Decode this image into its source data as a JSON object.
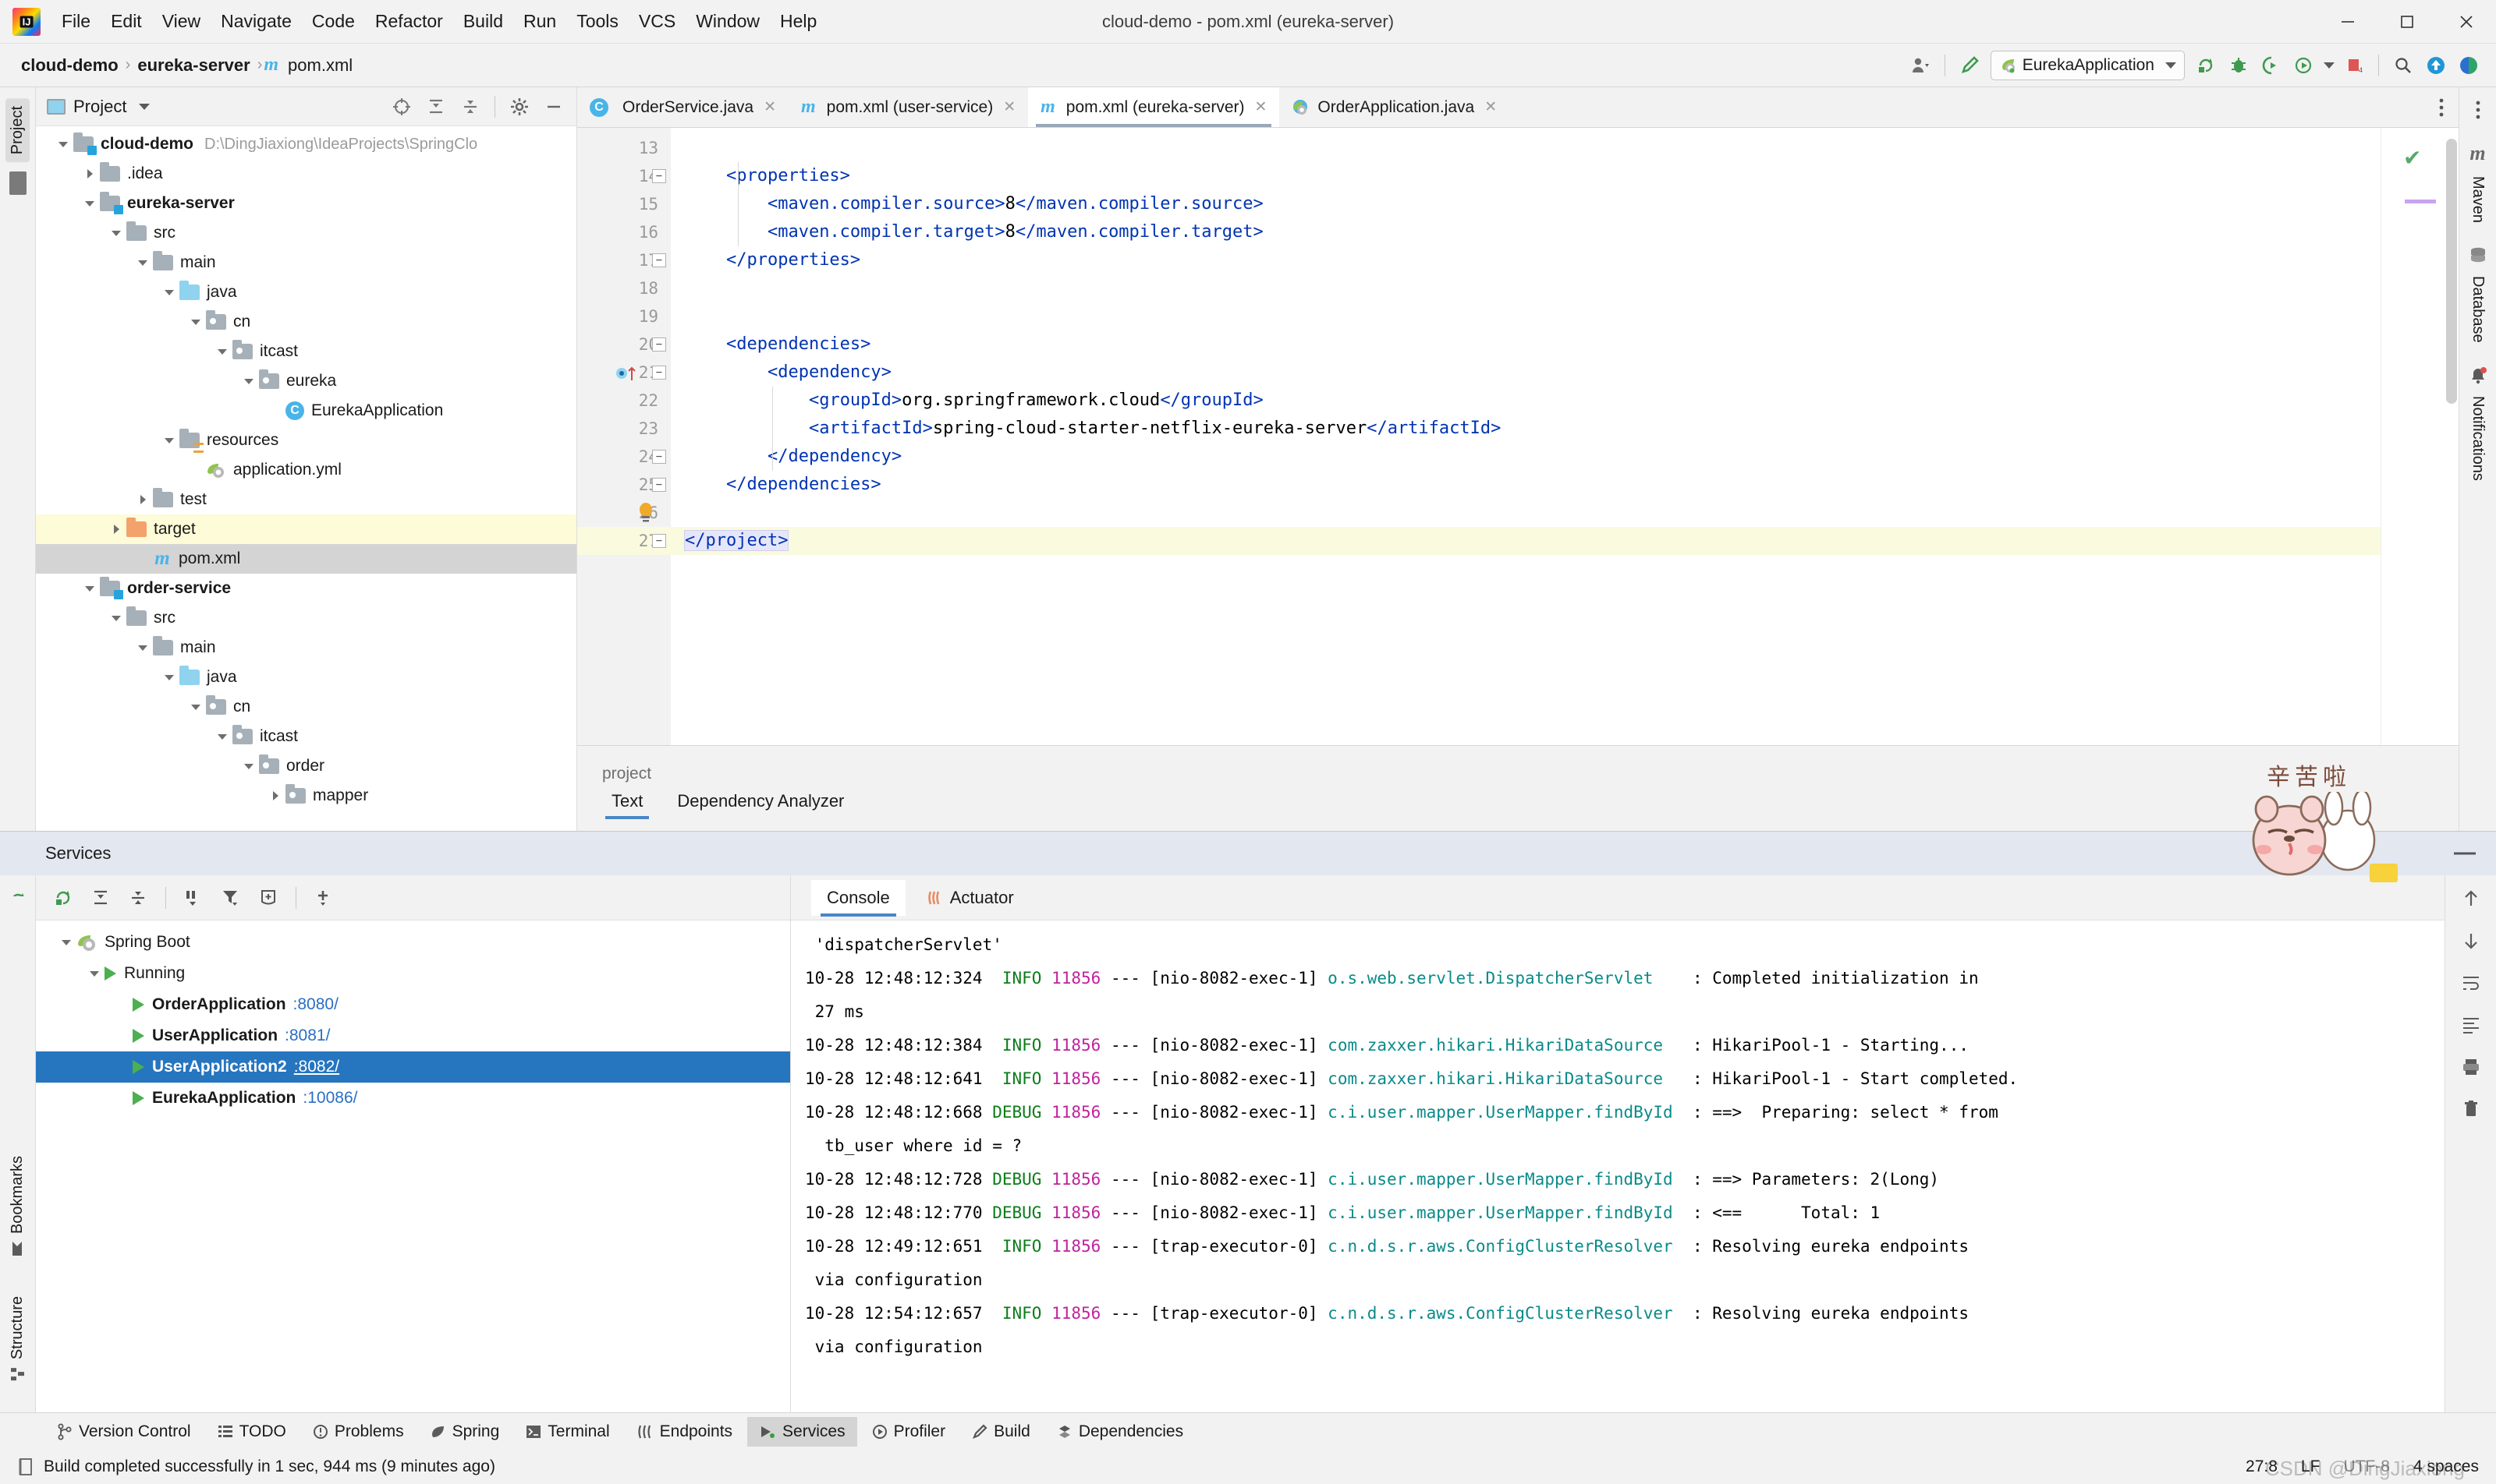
{
  "window": {
    "title": "cloud-demo - pom.xml (eureka-server)",
    "minimize_label": "—",
    "maximize_label": "❐",
    "close_label": "✕"
  },
  "menu": [
    {
      "label": "File"
    },
    {
      "label": "Edit"
    },
    {
      "label": "View"
    },
    {
      "label": "Navigate"
    },
    {
      "label": "Code"
    },
    {
      "label": "Refactor"
    },
    {
      "label": "Build"
    },
    {
      "label": "Run"
    },
    {
      "label": "Tools"
    },
    {
      "label": "VCS"
    },
    {
      "label": "Window"
    },
    {
      "label": "Help"
    }
  ],
  "navbar": {
    "breadcrumbs": [
      {
        "label": "cloud-demo",
        "bold": true
      },
      {
        "label": "eureka-server",
        "bold": true
      },
      {
        "label": "pom.xml",
        "bold": false,
        "icon": "maven-m-icon"
      }
    ],
    "separator": "›",
    "run_config": "EurekaApplication",
    "toolbar_icons": [
      "user-avatar-icon",
      "hammer-build-icon",
      "run-rerun-icon",
      "debug-bug-icon",
      "run-with-coverage-icon",
      "profiler-icon",
      "stop-icon",
      "search-icon",
      "update-project-icon",
      "ide-assistant-icon"
    ]
  },
  "left_strip": {
    "tabs": [
      "Project",
      "Bookmarks",
      "Structure"
    ]
  },
  "project_panel": {
    "title": "Project",
    "toolbar_icons": [
      "select-opened-file-icon",
      "expand-all-icon",
      "collapse-all-icon",
      "settings-gear-icon",
      "hide-icon"
    ],
    "tree": [
      {
        "depth": 0,
        "label": "cloud-demo",
        "path": "D:\\DingJiaxiong\\IdeaProjects\\SpringClo",
        "icon": "module-folder-icon",
        "arrow": "down",
        "bold": true
      },
      {
        "depth": 1,
        "label": ".idea",
        "icon": "folder-icon",
        "arrow": "right",
        "bold": false
      },
      {
        "depth": 1,
        "label": "eureka-server",
        "icon": "module-folder-icon",
        "arrow": "down",
        "bold": true
      },
      {
        "depth": 2,
        "label": "src",
        "icon": "folder-icon",
        "arrow": "down",
        "bold": false
      },
      {
        "depth": 3,
        "label": "main",
        "icon": "folder-icon",
        "arrow": "down",
        "bold": false
      },
      {
        "depth": 4,
        "label": "java",
        "icon": "source-folder-icon",
        "arrow": "down",
        "bold": false
      },
      {
        "depth": 5,
        "label": "cn",
        "icon": "package-folder-icon",
        "arrow": "down",
        "bold": false
      },
      {
        "depth": 6,
        "label": "itcast",
        "icon": "package-folder-icon",
        "arrow": "down",
        "bold": false
      },
      {
        "depth": 7,
        "label": "eureka",
        "icon": "package-folder-icon",
        "arrow": "down",
        "bold": false
      },
      {
        "depth": 8,
        "label": "EurekaApplication",
        "icon": "java-class-icon",
        "arrow": "none",
        "bold": false
      },
      {
        "depth": 4,
        "label": "resources",
        "icon": "resources-folder-icon",
        "arrow": "down",
        "bold": false
      },
      {
        "depth": 5,
        "label": "application.yml",
        "icon": "spring-yaml-icon",
        "arrow": "none",
        "bold": false
      },
      {
        "depth": 3,
        "label": "test",
        "icon": "folder-icon",
        "arrow": "right",
        "bold": false
      },
      {
        "depth": 2,
        "label": "target",
        "icon": "excluded-folder-icon",
        "arrow": "right",
        "bold": false,
        "highlight": "yellow"
      },
      {
        "depth": 3,
        "label": "pom.xml",
        "icon": "maven-m-icon",
        "arrow": "none",
        "bold": false,
        "highlight": "grey"
      },
      {
        "depth": 1,
        "label": "order-service",
        "icon": "module-folder-icon",
        "arrow": "down",
        "bold": true
      },
      {
        "depth": 2,
        "label": "src",
        "icon": "folder-icon",
        "arrow": "down",
        "bold": false
      },
      {
        "depth": 3,
        "label": "main",
        "icon": "folder-icon",
        "arrow": "down",
        "bold": false
      },
      {
        "depth": 4,
        "label": "java",
        "icon": "source-folder-icon",
        "arrow": "down",
        "bold": false
      },
      {
        "depth": 5,
        "label": "cn",
        "icon": "package-folder-icon",
        "arrow": "down",
        "bold": false
      },
      {
        "depth": 6,
        "label": "itcast",
        "icon": "package-folder-icon",
        "arrow": "down",
        "bold": false
      },
      {
        "depth": 7,
        "label": "order",
        "icon": "package-folder-icon",
        "arrow": "down",
        "bold": false
      },
      {
        "depth": 8,
        "label": "mapper",
        "icon": "package-folder-icon",
        "arrow": "right",
        "bold": false
      }
    ]
  },
  "editor": {
    "tabs": [
      {
        "label": "OrderService.java",
        "icon": "java-class-icon",
        "active": false
      },
      {
        "label": "pom.xml (user-service)",
        "icon": "maven-m-icon",
        "active": false
      },
      {
        "label": "pom.xml (eureka-server)",
        "icon": "maven-m-icon",
        "active": true
      },
      {
        "label": "OrderApplication.java",
        "icon": "spring-class-icon",
        "active": false
      }
    ],
    "lines": [
      {
        "no": "13",
        "text": "",
        "fold": "none"
      },
      {
        "no": "14",
        "text": "    <properties>",
        "fold": "start"
      },
      {
        "no": "15",
        "text": "        <maven.compiler.source>8</maven.compiler.source>",
        "fold": "none"
      },
      {
        "no": "16",
        "text": "        <maven.compiler.target>8</maven.compiler.target>",
        "fold": "none"
      },
      {
        "no": "17",
        "text": "    </properties>",
        "fold": "end"
      },
      {
        "no": "18",
        "text": "",
        "fold": "none"
      },
      {
        "no": "19",
        "text": "",
        "fold": "none"
      },
      {
        "no": "20",
        "text": "    <dependencies>",
        "fold": "start"
      },
      {
        "no": "21",
        "text": "        <dependency>",
        "fold": "start",
        "marker": "run-gutter-icon"
      },
      {
        "no": "22",
        "text": "            <groupId>org.springframework.cloud</groupId>",
        "fold": "none"
      },
      {
        "no": "23",
        "text": "            <artifactId>spring-cloud-starter-netflix-eureka-server</artifactId>",
        "fold": "none"
      },
      {
        "no": "24",
        "text": "        </dependency>",
        "fold": "end"
      },
      {
        "no": "25",
        "text": "    </dependencies>",
        "fold": "end"
      },
      {
        "no": "26",
        "text": "",
        "fold": "none",
        "marker": "intention-bulb-icon"
      },
      {
        "no": "27",
        "text": "</project>",
        "fold": "end",
        "highlight": true
      }
    ],
    "footer": {
      "label": "project",
      "tabs": [
        {
          "label": "Text",
          "active": true
        },
        {
          "label": "Dependency Analyzer",
          "active": false
        }
      ]
    },
    "inspection_status": "ok"
  },
  "right_strip": {
    "tabs": [
      {
        "label": "Maven",
        "icon": "maven-m-icon"
      },
      {
        "label": "Database",
        "icon": "database-icon"
      },
      {
        "label": "Notifications",
        "icon": "bell-icon",
        "badge": true
      }
    ]
  },
  "services": {
    "title": "Services",
    "toolbar_icons": [
      "rerun-icon",
      "expand-all-icon",
      "collapse-all-icon",
      "group-by-icon",
      "filter-icon",
      "show-config-icon",
      "add-service-icon"
    ],
    "side_icons": [
      "rerun-icon",
      "debug-icon",
      "stop-icon",
      "wrench-icon",
      "camera-icon",
      "settings-icon",
      "exit-icon",
      "layout-icon"
    ],
    "tree": [
      {
        "depth": 0,
        "label": "Spring Boot",
        "port": "",
        "icon": "spring-boot-icon",
        "arrow": "down",
        "bold": false,
        "selected": false
      },
      {
        "depth": 1,
        "label": "Running",
        "port": "",
        "icon": "run-play-icon",
        "arrow": "down",
        "bold": false,
        "selected": false
      },
      {
        "depth": 2,
        "label": "OrderApplication",
        "port": ":8080/",
        "icon": "run-play-icon",
        "arrow": "none",
        "bold": true,
        "selected": false
      },
      {
        "depth": 2,
        "label": "UserApplication",
        "port": ":8081/",
        "icon": "run-play-icon",
        "arrow": "none",
        "bold": true,
        "selected": false
      },
      {
        "depth": 2,
        "label": "UserApplication2",
        "port": ":8082/",
        "icon": "run-play-icon",
        "arrow": "none",
        "bold": true,
        "selected": true
      },
      {
        "depth": 2,
        "label": "EurekaApplication",
        "port": ":10086/",
        "icon": "run-play-icon",
        "arrow": "none",
        "bold": true,
        "selected": false
      }
    ],
    "console_tabs": [
      {
        "label": "Console",
        "active": true,
        "icon": "console-icon"
      },
      {
        "label": "Actuator",
        "active": false,
        "icon": "actuator-icon"
      }
    ],
    "console_lines": [
      {
        "type": "cont",
        "text": " 'dispatcherServlet'"
      },
      {
        "type": "log",
        "ts": "10-28 12:48:12:324",
        "level": "INFO",
        "pid": "11856",
        "thread": "[nio-8082-exec-1]",
        "logger": "o.s.web.servlet.DispatcherServlet",
        "msg": ": Completed initialization in"
      },
      {
        "type": "cont",
        "text": " 27 ms"
      },
      {
        "type": "log",
        "ts": "10-28 12:48:12:384",
        "level": "INFO",
        "pid": "11856",
        "thread": "[nio-8082-exec-1]",
        "logger": "com.zaxxer.hikari.HikariDataSource",
        "msg": ": HikariPool-1 - Starting..."
      },
      {
        "type": "log",
        "ts": "10-28 12:48:12:641",
        "level": "INFO",
        "pid": "11856",
        "thread": "[nio-8082-exec-1]",
        "logger": "com.zaxxer.hikari.HikariDataSource",
        "msg": ": HikariPool-1 - Start completed."
      },
      {
        "type": "log",
        "ts": "10-28 12:48:12:668",
        "level": "DEBUG",
        "pid": "11856",
        "thread": "[nio-8082-exec-1]",
        "logger": "c.i.user.mapper.UserMapper.findById",
        "msg": ": ==>  Preparing: select * from"
      },
      {
        "type": "cont",
        "text": "  tb_user where id = ?"
      },
      {
        "type": "log",
        "ts": "10-28 12:48:12:728",
        "level": "DEBUG",
        "pid": "11856",
        "thread": "[nio-8082-exec-1]",
        "logger": "c.i.user.mapper.UserMapper.findById",
        "msg": ": ==> Parameters: 2(Long)"
      },
      {
        "type": "log",
        "ts": "10-28 12:48:12:770",
        "level": "DEBUG",
        "pid": "11856",
        "thread": "[nio-8082-exec-1]",
        "logger": "c.i.user.mapper.UserMapper.findById",
        "msg": ": <==      Total: 1"
      },
      {
        "type": "log",
        "ts": "10-28 12:49:12:651",
        "level": "INFO",
        "pid": "11856",
        "thread": "[trap-executor-0]",
        "logger": "c.n.d.s.r.aws.ConfigClusterResolver",
        "msg": ": Resolving eureka endpoints"
      },
      {
        "type": "cont",
        "text": " via configuration"
      },
      {
        "type": "log",
        "ts": "10-28 12:54:12:657",
        "level": "INFO",
        "pid": "11856",
        "thread": "[trap-executor-0]",
        "logger": "c.n.d.s.r.aws.ConfigClusterResolver",
        "msg": ": Resolving eureka endpoints"
      },
      {
        "type": "cont",
        "text": " via configuration"
      }
    ]
  },
  "sticker": {
    "text": "辛苦啦"
  },
  "toolwindow_bar": [
    {
      "label": "Version Control",
      "icon": "branch-icon",
      "active": false
    },
    {
      "label": "TODO",
      "icon": "todo-list-icon",
      "active": false
    },
    {
      "label": "Problems",
      "icon": "problems-icon",
      "active": false
    },
    {
      "label": "Spring",
      "icon": "spring-leaf-icon",
      "active": false
    },
    {
      "label": "Terminal",
      "icon": "terminal-icon",
      "active": false
    },
    {
      "label": "Endpoints",
      "icon": "endpoints-icon",
      "active": false
    },
    {
      "label": "Services",
      "icon": "services-icon",
      "active": true
    },
    {
      "label": "Profiler",
      "icon": "profiler-icon",
      "active": false
    },
    {
      "label": "Build",
      "icon": "build-hammer-icon",
      "active": false
    },
    {
      "label": "Dependencies",
      "icon": "dependencies-icon",
      "active": false
    }
  ],
  "statusbar": {
    "message": "Build completed successfully in 1 sec, 944 ms (9 minutes ago)",
    "caret": "27:8",
    "line_sep": "LF",
    "encoding": "UTF-8",
    "indent": "4 spaces",
    "watermark": "CSDN @DingJiaxiong"
  },
  "colors": {
    "accent_blue": "#2675bf",
    "xml_tag": "#0033b3",
    "log_info": "#0a7d19",
    "log_pid": "#c0229c",
    "log_logger": "#0a8a8a",
    "folder_grey": "#a6b0b8",
    "folder_blue": "#8fd3ef",
    "folder_orange": "#f4a26b"
  }
}
